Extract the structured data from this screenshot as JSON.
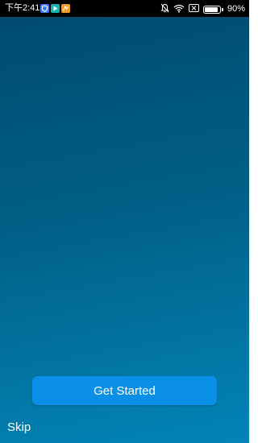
{
  "status_bar": {
    "time": "下午2:41",
    "battery_percent": "90%",
    "battery_level": 0.9,
    "notification_icons": [
      "shield-app-icon",
      "play-app-icon",
      "orange-app-icon"
    ],
    "system_icons": [
      "mute-bell-icon",
      "wifi-icon",
      "no-sim-icon",
      "battery-icon"
    ]
  },
  "main": {
    "get_started_label": "Get Started",
    "skip_label": "Skip"
  },
  "colors": {
    "background_top": "#014a6d",
    "background_bottom": "#0284b7",
    "button": "#0a8fe6",
    "status_bar": "#000000"
  }
}
